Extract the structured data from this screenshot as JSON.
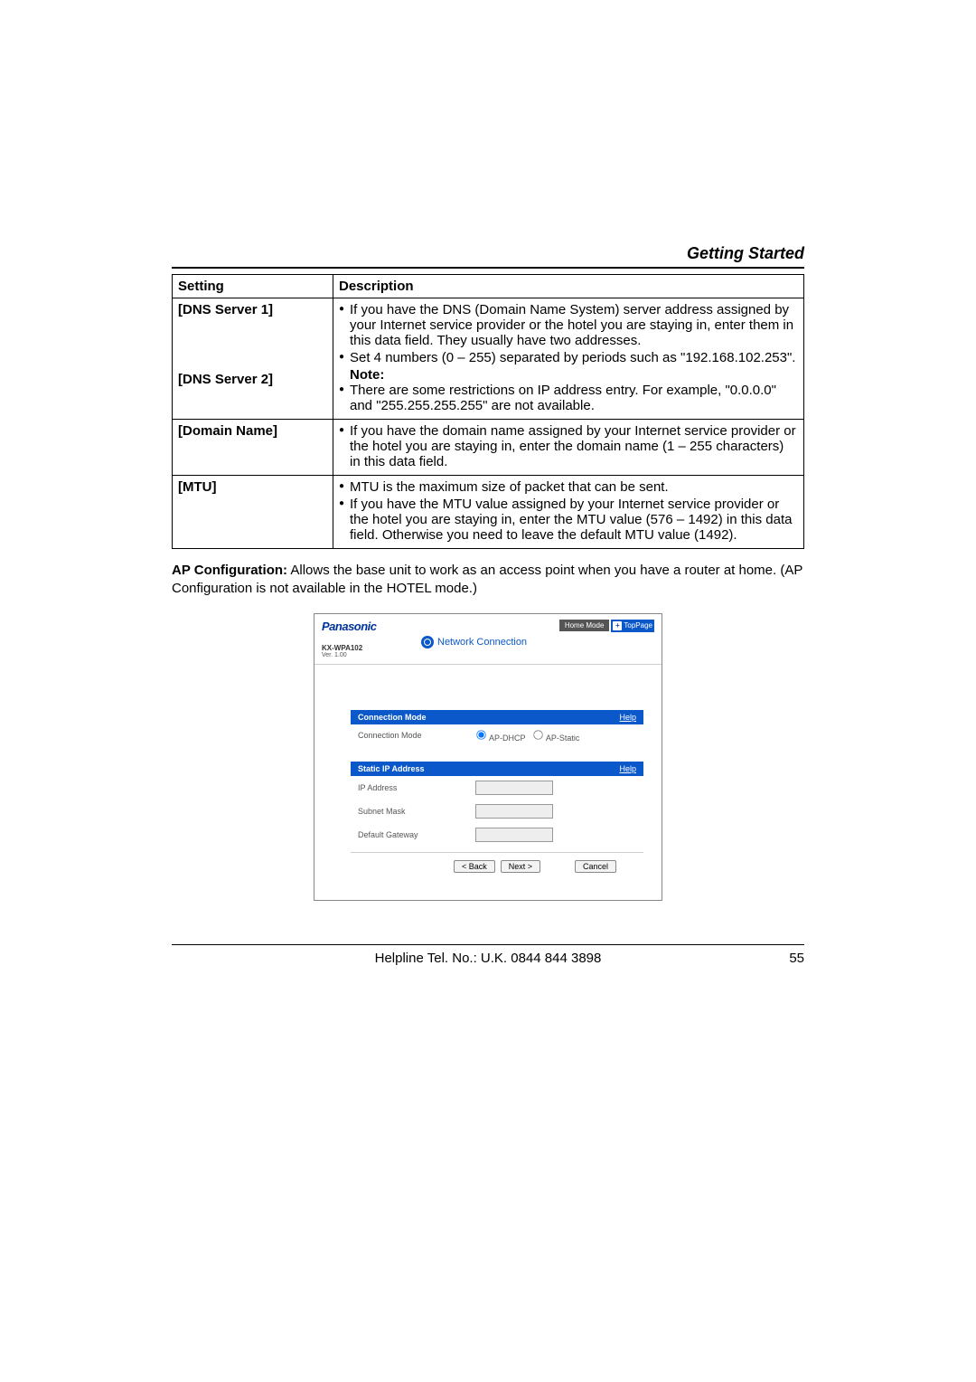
{
  "header": {
    "section": "Getting Started"
  },
  "table": {
    "col_setting": "Setting",
    "col_description": "Description",
    "rows": {
      "dns1_label": "[DNS Server 1]",
      "dns2_label": "[DNS Server 2]",
      "dns_b1": "If you have the DNS (Domain Name System) server address assigned by your Internet service provider or the hotel you are staying in, enter them in this data field. They usually have two addresses.",
      "dns_b2": "Set 4 numbers (0 – 255) separated by periods such as \"192.168.102.253\".",
      "note_label": "Note:",
      "dns_b3": "There are some restrictions on IP address entry. For example, \"0.0.0.0\" and \"255.255.255.255\" are not available.",
      "domain_label": "[Domain Name]",
      "domain_b1": "If you have the domain name assigned by your Internet service provider or the hotel you are staying in, enter the domain name (1 – 255 characters) in this data field.",
      "mtu_label": "[MTU]",
      "mtu_b1": "MTU is the maximum size of packet that can be sent.",
      "mtu_b2": "If you have the MTU value assigned by your Internet service provider or the hotel you are staying in, enter the MTU value (576 – 1492) in this data field. Otherwise you need to leave the default MTU value (1492)."
    }
  },
  "body": {
    "ap_bold": "AP Configuration:",
    "ap_text": " Allows the base unit to work as an access point when you have a router at home. (AP Configuration is not available in the HOTEL mode.)"
  },
  "screenshot": {
    "brand": "Panasonic",
    "model": "KX-WPA102",
    "version": "Ver. 1.00",
    "page_title": "Network Connection",
    "mode_label": "Home Mode",
    "top_page": "TopPage",
    "panel1_title": "Connection Mode",
    "panel1_help": "Help",
    "row_conn_mode": "Connection Mode",
    "radio_dhcp": "AP-DHCP",
    "radio_static": "AP-Static",
    "panel2_title": "Static IP Address",
    "panel2_help": "Help",
    "row_ip": "IP Address",
    "row_subnet": "Subnet Mask",
    "row_gateway": "Default Gateway",
    "btn_back": "< Back",
    "btn_next": "Next >",
    "btn_cancel": "Cancel"
  },
  "footer": {
    "helpline": "Helpline Tel. No.: U.K. 0844 844 3898",
    "page": "55"
  }
}
